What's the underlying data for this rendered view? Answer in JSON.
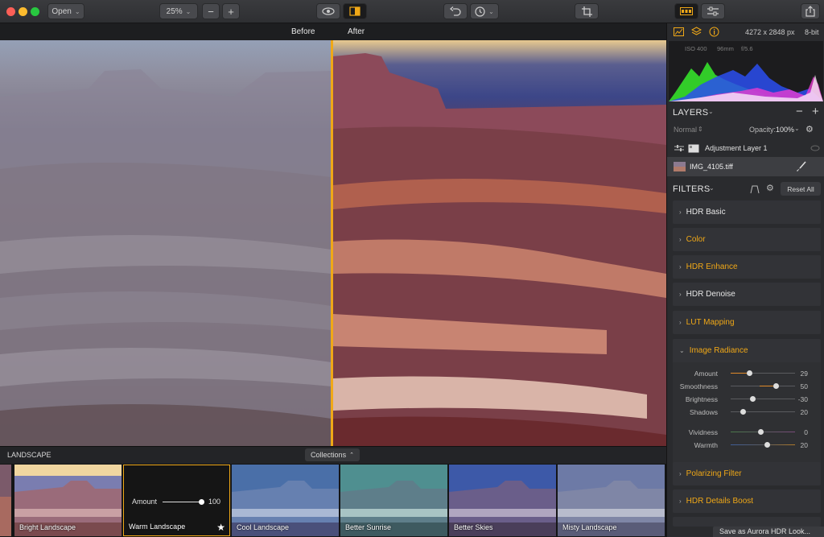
{
  "toolbar": {
    "open_label": "Open",
    "zoom_value": "25%",
    "zoom_out": "−",
    "zoom_in": "+"
  },
  "viewer": {
    "before_label": "Before",
    "after_label": "After"
  },
  "info": {
    "dimensions": "4272 x 2848 px",
    "bit_depth": "8-bit",
    "iso": "ISO 400",
    "focal": "96mm",
    "aperture": "f/5.6"
  },
  "layers": {
    "title": "LAYERS",
    "blend_mode": "Normal",
    "opacity_label": "Opacity:",
    "opacity_value": "100%",
    "adjustment_layer": "Adjustment Layer 1",
    "image_layer": "IMG_4105.tiff"
  },
  "filters": {
    "title": "FILTERS",
    "reset_label": "Reset All",
    "items": [
      {
        "name": "HDR Basic"
      },
      {
        "name": "Color"
      },
      {
        "name": "HDR Enhance"
      },
      {
        "name": "HDR Denoise"
      },
      {
        "name": "LUT Mapping"
      },
      {
        "name": "Image Radiance"
      },
      {
        "name": "Polarizing Filter"
      },
      {
        "name": "HDR Details Boost"
      }
    ],
    "radiance_sliders": [
      {
        "label": "Amount",
        "value": "29"
      },
      {
        "label": "Smoothness",
        "value": "50"
      },
      {
        "label": "Brightness",
        "value": "-30"
      },
      {
        "label": "Shadows",
        "value": "20"
      },
      {
        "label": "Vividness",
        "value": "0"
      },
      {
        "label": "Warmth",
        "value": "20"
      }
    ]
  },
  "strip": {
    "category": "LANDSCAPE",
    "collections_label": "Collections",
    "amount_label": "Amount",
    "amount_value": "100",
    "presets": [
      {
        "name": "Bright Landscape"
      },
      {
        "name": "Warm Landscape"
      },
      {
        "name": "Cool Landscape"
      },
      {
        "name": "Better Sunrise"
      },
      {
        "name": "Better Skies"
      },
      {
        "name": "Misty Landscape"
      }
    ]
  },
  "save_look_label": "Save as Aurora HDR Look...",
  "colors": {
    "accent": "#f0a817",
    "close": "#fc5f57",
    "minimize": "#fdbb2e",
    "zoom": "#28c840"
  }
}
